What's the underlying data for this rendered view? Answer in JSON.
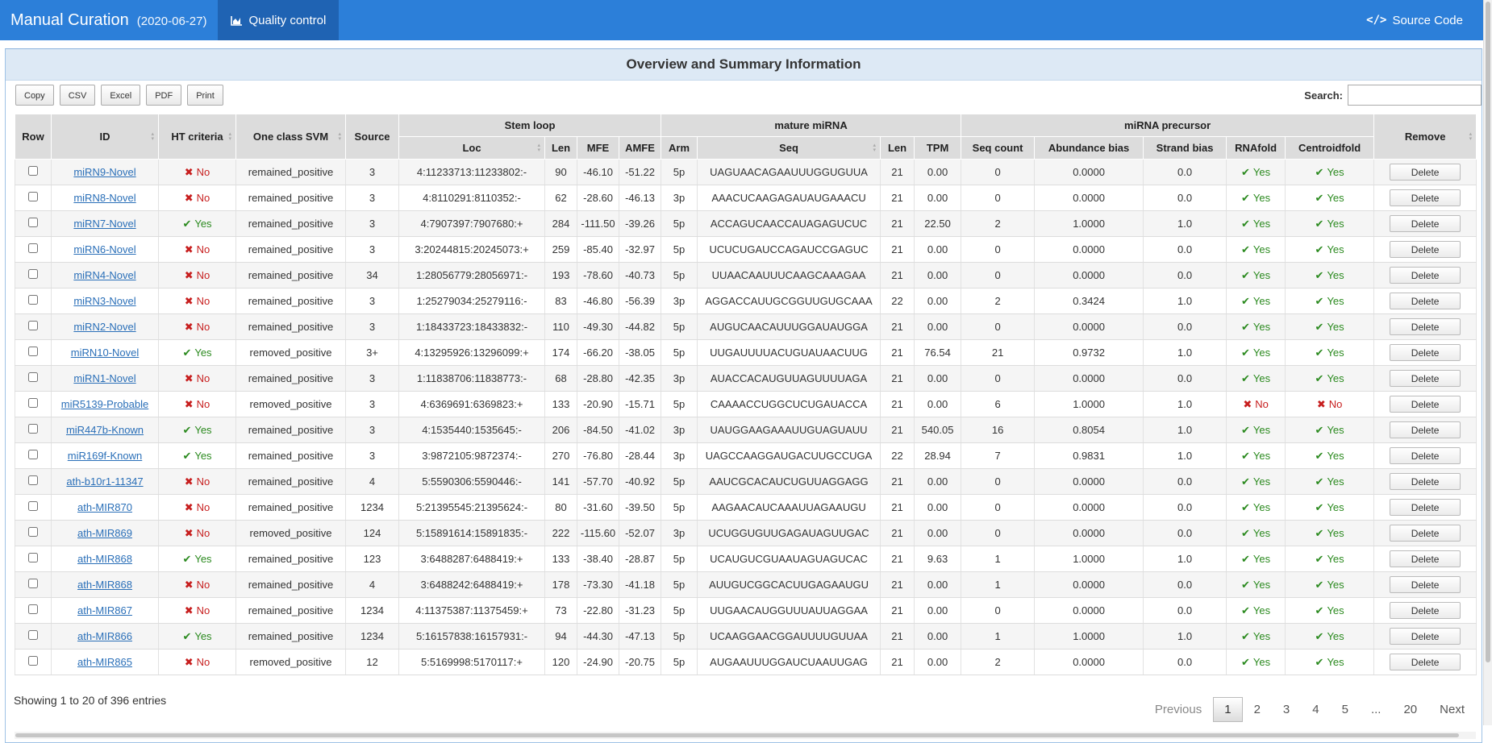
{
  "nav": {
    "title": "Manual Curation",
    "date": "(2020-06-27)",
    "qc_label": "Quality control",
    "source_label": "Source Code"
  },
  "panel": {
    "title": "Overview and Summary Information"
  },
  "toolbar": {
    "buttons": [
      "Copy",
      "CSV",
      "Excel",
      "PDF",
      "Print"
    ]
  },
  "search": {
    "label": "Search:",
    "value": ""
  },
  "headers": {
    "row": "Row",
    "id": "ID",
    "ht": "HT criteria",
    "svm": "One class SVM",
    "source": "Source",
    "stem_loop": "Stem loop",
    "mature": "mature miRNA",
    "precursor": "miRNA precursor",
    "remove": "Remove",
    "loc": "Loc",
    "len": "Len",
    "mfe": "MFE",
    "amfe": "AMFE",
    "arm": "Arm",
    "seq": "Seq",
    "mlen": "Len",
    "tpm": "TPM",
    "seqcount": "Seq count",
    "abund": "Abundance bias",
    "strand": "Strand bias",
    "rnafold": "RNAfold",
    "centroid": "Centroidfold"
  },
  "labels": {
    "yes": "Yes",
    "no": "No",
    "delete": "Delete"
  },
  "colors": {
    "navbar": "#2c7fd9",
    "nav_active": "#1f63b3",
    "yes": "#2b8a1f",
    "no": "#c71e1e",
    "link": "#2a6fb8"
  },
  "rows": [
    {
      "id": "miRN9-Novel",
      "ht": false,
      "svm": "remained_positive",
      "source": "3",
      "loc": "4:11233713:11233802:-",
      "len": "90",
      "mfe": "-46.10",
      "amfe": "-51.22",
      "arm": "5p",
      "seq": "UAGUAACAGAAUUUGGUGUUA",
      "mlen": "21",
      "tpm": "0.00",
      "seqcount": "0",
      "abund": "0.0000",
      "strand": "0.0",
      "rnafold": true,
      "centroid": true
    },
    {
      "id": "miRN8-Novel",
      "ht": false,
      "svm": "remained_positive",
      "source": "3",
      "loc": "4:8110291:8110352:-",
      "len": "62",
      "mfe": "-28.60",
      "amfe": "-46.13",
      "arm": "3p",
      "seq": "AAACUCAAGAGAUAUGAAACU",
      "mlen": "21",
      "tpm": "0.00",
      "seqcount": "0",
      "abund": "0.0000",
      "strand": "0.0",
      "rnafold": true,
      "centroid": true
    },
    {
      "id": "miRN7-Novel",
      "ht": true,
      "svm": "remained_positive",
      "source": "3",
      "loc": "4:7907397:7907680:+",
      "len": "284",
      "mfe": "-111.50",
      "amfe": "-39.26",
      "arm": "5p",
      "seq": "ACCAGUCAACCAUAGAGUCUC",
      "mlen": "21",
      "tpm": "22.50",
      "seqcount": "2",
      "abund": "1.0000",
      "strand": "1.0",
      "rnafold": true,
      "centroid": true
    },
    {
      "id": "miRN6-Novel",
      "ht": false,
      "svm": "remained_positive",
      "source": "3",
      "loc": "3:20244815:20245073:+",
      "len": "259",
      "mfe": "-85.40",
      "amfe": "-32.97",
      "arm": "5p",
      "seq": "UCUCUGAUCCAGAUCCGAGUC",
      "mlen": "21",
      "tpm": "0.00",
      "seqcount": "0",
      "abund": "0.0000",
      "strand": "0.0",
      "rnafold": true,
      "centroid": true
    },
    {
      "id": "miRN4-Novel",
      "ht": false,
      "svm": "remained_positive",
      "source": "34",
      "loc": "1:28056779:28056971:-",
      "len": "193",
      "mfe": "-78.60",
      "amfe": "-40.73",
      "arm": "5p",
      "seq": "UUAACAAUUUCAAGCAAAGAA",
      "mlen": "21",
      "tpm": "0.00",
      "seqcount": "0",
      "abund": "0.0000",
      "strand": "0.0",
      "rnafold": true,
      "centroid": true
    },
    {
      "id": "miRN3-Novel",
      "ht": false,
      "svm": "remained_positive",
      "source": "3",
      "loc": "1:25279034:25279116:-",
      "len": "83",
      "mfe": "-46.80",
      "amfe": "-56.39",
      "arm": "3p",
      "seq": "AGGACCAUUGCGGUUGUGCAAA",
      "mlen": "22",
      "tpm": "0.00",
      "seqcount": "2",
      "abund": "0.3424",
      "strand": "1.0",
      "rnafold": true,
      "centroid": true
    },
    {
      "id": "miRN2-Novel",
      "ht": false,
      "svm": "remained_positive",
      "source": "3",
      "loc": "1:18433723:18433832:-",
      "len": "110",
      "mfe": "-49.30",
      "amfe": "-44.82",
      "arm": "5p",
      "seq": "AUGUCAACAUUUGGAUAUGGA",
      "mlen": "21",
      "tpm": "0.00",
      "seqcount": "0",
      "abund": "0.0000",
      "strand": "0.0",
      "rnafold": true,
      "centroid": true
    },
    {
      "id": "miRN10-Novel",
      "ht": true,
      "svm": "removed_positive",
      "source": "3+",
      "loc": "4:13295926:13296099:+",
      "len": "174",
      "mfe": "-66.20",
      "amfe": "-38.05",
      "arm": "5p",
      "seq": "UUGAUUUUACUGUAUAACUUG",
      "mlen": "21",
      "tpm": "76.54",
      "seqcount": "21",
      "abund": "0.9732",
      "strand": "1.0",
      "rnafold": true,
      "centroid": true
    },
    {
      "id": "miRN1-Novel",
      "ht": false,
      "svm": "remained_positive",
      "source": "3",
      "loc": "1:11838706:11838773:-",
      "len": "68",
      "mfe": "-28.80",
      "amfe": "-42.35",
      "arm": "3p",
      "seq": "AUACCACAUGUUAGUUUUAGA",
      "mlen": "21",
      "tpm": "0.00",
      "seqcount": "0",
      "abund": "0.0000",
      "strand": "0.0",
      "rnafold": true,
      "centroid": true
    },
    {
      "id": "miR5139-Probable",
      "ht": false,
      "svm": "removed_positive",
      "source": "3",
      "loc": "4:6369691:6369823:+",
      "len": "133",
      "mfe": "-20.90",
      "amfe": "-15.71",
      "arm": "5p",
      "seq": "CAAAACCUGGCUCUGAUACCA",
      "mlen": "21",
      "tpm": "0.00",
      "seqcount": "6",
      "abund": "1.0000",
      "strand": "1.0",
      "rnafold": false,
      "centroid": false
    },
    {
      "id": "miR447b-Known",
      "ht": true,
      "svm": "remained_positive",
      "source": "3",
      "loc": "4:1535440:1535645:-",
      "len": "206",
      "mfe": "-84.50",
      "amfe": "-41.02",
      "arm": "3p",
      "seq": "UAUGGAAGAAAUUGUAGUAUU",
      "mlen": "21",
      "tpm": "540.05",
      "seqcount": "16",
      "abund": "0.8054",
      "strand": "1.0",
      "rnafold": true,
      "centroid": true
    },
    {
      "id": "miR169f-Known",
      "ht": true,
      "svm": "remained_positive",
      "source": "3",
      "loc": "3:9872105:9872374:-",
      "len": "270",
      "mfe": "-76.80",
      "amfe": "-28.44",
      "arm": "3p",
      "seq": "UAGCCAAGGAUGACUUGCCUGA",
      "mlen": "22",
      "tpm": "28.94",
      "seqcount": "7",
      "abund": "0.9831",
      "strand": "1.0",
      "rnafold": true,
      "centroid": true
    },
    {
      "id": "ath-b10r1-11347",
      "ht": false,
      "svm": "remained_positive",
      "source": "4",
      "loc": "5:5590306:5590446:-",
      "len": "141",
      "mfe": "-57.70",
      "amfe": "-40.92",
      "arm": "5p",
      "seq": "AAUCGCACAUCUGUUAGGAGG",
      "mlen": "21",
      "tpm": "0.00",
      "seqcount": "0",
      "abund": "0.0000",
      "strand": "0.0",
      "rnafold": true,
      "centroid": true
    },
    {
      "id": "ath-MIR870",
      "ht": false,
      "svm": "remained_positive",
      "source": "1234",
      "loc": "5:21395545:21395624:-",
      "len": "80",
      "mfe": "-31.60",
      "amfe": "-39.50",
      "arm": "5p",
      "seq": "AAGAACAUCAAAUUAGAAUGU",
      "mlen": "21",
      "tpm": "0.00",
      "seqcount": "0",
      "abund": "0.0000",
      "strand": "0.0",
      "rnafold": true,
      "centroid": true
    },
    {
      "id": "ath-MIR869",
      "ht": false,
      "svm": "removed_positive",
      "source": "124",
      "loc": "5:15891614:15891835:-",
      "len": "222",
      "mfe": "-115.60",
      "amfe": "-52.07",
      "arm": "3p",
      "seq": "UCUGGUGUUGAGAUAGUUGAC",
      "mlen": "21",
      "tpm": "0.00",
      "seqcount": "0",
      "abund": "0.0000",
      "strand": "0.0",
      "rnafold": true,
      "centroid": true
    },
    {
      "id": "ath-MIR868",
      "ht": true,
      "svm": "remained_positive",
      "source": "123",
      "loc": "3:6488287:6488419:+",
      "len": "133",
      "mfe": "-38.40",
      "amfe": "-28.87",
      "arm": "5p",
      "seq": "UCAUGUCGUAAUAGUAGUCAC",
      "mlen": "21",
      "tpm": "9.63",
      "seqcount": "1",
      "abund": "1.0000",
      "strand": "1.0",
      "rnafold": true,
      "centroid": true
    },
    {
      "id": "ath-MIR868",
      "ht": false,
      "svm": "remained_positive",
      "source": "4",
      "loc": "3:6488242:6488419:+",
      "len": "178",
      "mfe": "-73.30",
      "amfe": "-41.18",
      "arm": "5p",
      "seq": "AUUGUCGGCACUUGAGAAUGU",
      "mlen": "21",
      "tpm": "0.00",
      "seqcount": "1",
      "abund": "0.0000",
      "strand": "0.0",
      "rnafold": true,
      "centroid": true
    },
    {
      "id": "ath-MIR867",
      "ht": false,
      "svm": "remained_positive",
      "source": "1234",
      "loc": "4:11375387:11375459:+",
      "len": "73",
      "mfe": "-22.80",
      "amfe": "-31.23",
      "arm": "5p",
      "seq": "UUGAACAUGGUUUAUUAGGAA",
      "mlen": "21",
      "tpm": "0.00",
      "seqcount": "0",
      "abund": "0.0000",
      "strand": "0.0",
      "rnafold": true,
      "centroid": true
    },
    {
      "id": "ath-MIR866",
      "ht": true,
      "svm": "remained_positive",
      "source": "1234",
      "loc": "5:16157838:16157931:-",
      "len": "94",
      "mfe": "-44.30",
      "amfe": "-47.13",
      "arm": "5p",
      "seq": "UCAAGGAACGGAUUUUGUUAA",
      "mlen": "21",
      "tpm": "0.00",
      "seqcount": "1",
      "abund": "1.0000",
      "strand": "1.0",
      "rnafold": true,
      "centroid": true
    },
    {
      "id": "ath-MIR865",
      "ht": false,
      "svm": "removed_positive",
      "source": "12",
      "loc": "5:5169998:5170117:+",
      "len": "120",
      "mfe": "-24.90",
      "amfe": "-20.75",
      "arm": "5p",
      "seq": "AUGAAUUUGGAUCUAAUUGAG",
      "mlen": "21",
      "tpm": "0.00",
      "seqcount": "2",
      "abund": "0.0000",
      "strand": "0.0",
      "rnafold": true,
      "centroid": true
    }
  ],
  "footer": {
    "info": "Showing 1 to 20 of 396 entries",
    "previous": "Previous",
    "next": "Next",
    "pages": [
      "1",
      "2",
      "3",
      "4",
      "5",
      "...",
      "20"
    ],
    "current_page": "1"
  }
}
